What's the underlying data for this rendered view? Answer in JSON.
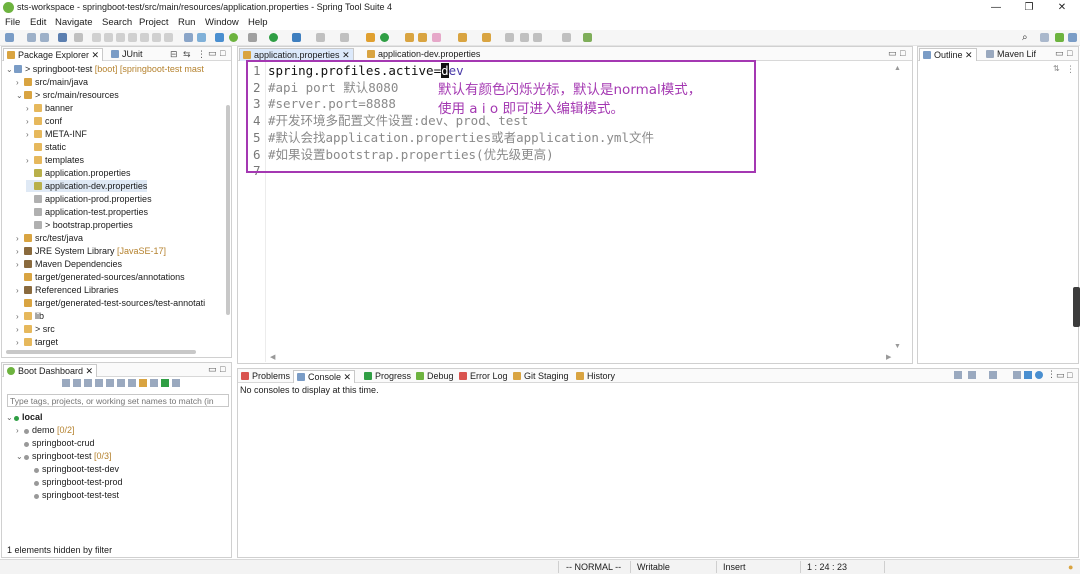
{
  "window": {
    "title": "sts-workspace - springboot-test/src/main/resources/application.properties - Spring Tool Suite 4",
    "min_glyph": "—",
    "max_glyph": "❐",
    "close_glyph": "✕"
  },
  "menu": [
    "File",
    "Edit",
    "Navigate",
    "Search",
    "Project",
    "Run",
    "Window",
    "Help"
  ],
  "package_explorer": {
    "tabs": [
      "Package Explorer",
      "JUnit"
    ],
    "items": [
      {
        "label": "> springboot-test",
        "extra": "[boot] [springboot-test mast",
        "depth": 0,
        "arrow": "v",
        "icon": "project"
      },
      {
        "label": "src/main/java",
        "depth": 1,
        "arrow": ">",
        "icon": "srcfolder"
      },
      {
        "label": "> src/main/resources",
        "depth": 1,
        "arrow": "v",
        "icon": "srcfolder"
      },
      {
        "label": "banner",
        "depth": 2,
        "arrow": ">",
        "icon": "folder"
      },
      {
        "label": "conf",
        "depth": 2,
        "arrow": ">",
        "icon": "folder"
      },
      {
        "label": "META-INF",
        "depth": 2,
        "arrow": ">",
        "icon": "folder"
      },
      {
        "label": "static",
        "depth": 2,
        "arrow": "",
        "icon": "folder"
      },
      {
        "label": "templates",
        "depth": 2,
        "arrow": ">",
        "icon": "folder"
      },
      {
        "label": "application.properties",
        "depth": 2,
        "arrow": "",
        "icon": "propfile"
      },
      {
        "label": "application-dev.properties",
        "depth": 2,
        "arrow": "",
        "icon": "propfile",
        "selected": true
      },
      {
        "label": "application-prod.properties",
        "depth": 2,
        "arrow": "",
        "icon": "file"
      },
      {
        "label": "application-test.properties",
        "depth": 2,
        "arrow": "",
        "icon": "file"
      },
      {
        "label": "> bootstrap.properties",
        "depth": 2,
        "arrow": "",
        "icon": "file"
      },
      {
        "label": "src/test/java",
        "depth": 1,
        "arrow": ">",
        "icon": "srcfolder"
      },
      {
        "label": "JRE System Library",
        "extra": "[JavaSE-17]",
        "depth": 1,
        "arrow": ">",
        "icon": "lib"
      },
      {
        "label": "Maven Dependencies",
        "depth": 1,
        "arrow": ">",
        "icon": "lib"
      },
      {
        "label": "target/generated-sources/annotations",
        "depth": 1,
        "arrow": "",
        "icon": "srcfolder"
      },
      {
        "label": "Referenced Libraries",
        "depth": 1,
        "arrow": ">",
        "icon": "lib"
      },
      {
        "label": "target/generated-test-sources/test-annotati",
        "depth": 1,
        "arrow": "",
        "icon": "srcfolder"
      },
      {
        "label": "lib",
        "depth": 1,
        "arrow": ">",
        "icon": "folder"
      },
      {
        "label": "> src",
        "depth": 1,
        "arrow": ">",
        "icon": "folder"
      },
      {
        "label": "target",
        "depth": 1,
        "arrow": ">",
        "icon": "folder"
      }
    ]
  },
  "boot_dashboard": {
    "tab": "Boot Dashboard",
    "filter_placeholder": "Type tags, projects, or working set names to match (in",
    "items": [
      {
        "label": "local",
        "depth": 0,
        "arrow": "v",
        "bold": true
      },
      {
        "label": "demo",
        "extra": "[0/2]",
        "depth": 1,
        "arrow": ">"
      },
      {
        "label": "springboot-crud",
        "depth": 1,
        "arrow": ""
      },
      {
        "label": "springboot-test",
        "extra": "[0/3]",
        "depth": 1,
        "arrow": "v"
      },
      {
        "label": "springboot-test-dev",
        "depth": 2,
        "arrow": ""
      },
      {
        "label": "springboot-test-prod",
        "depth": 2,
        "arrow": ""
      },
      {
        "label": "springboot-test-test",
        "depth": 2,
        "arrow": ""
      }
    ],
    "footer": "1 elements hidden by filter"
  },
  "editor": {
    "tabs": [
      "application.properties",
      "application-dev.properties"
    ],
    "lines": [
      {
        "num": "1",
        "text": "spring.profiles.active=",
        "cursor": "d",
        "rest": "ev",
        "comment": false
      },
      {
        "num": "2",
        "text": "#api port 默认8080",
        "comment": true
      },
      {
        "num": "3",
        "text": "#server.port=8888",
        "comment": true
      },
      {
        "num": "4",
        "text": "#开发环境多配置文件设置:dev、prod、test",
        "comment": true
      },
      {
        "num": "5",
        "text": "#默认会找application.properties或者application.yml文件",
        "comment": true
      },
      {
        "num": "6",
        "text": "#如果设置bootstrap.properties(优先级更高)",
        "comment": true
      },
      {
        "num": "7",
        "text": "",
        "comment": false
      }
    ],
    "annotation_line1": "默认有颜色闪烁光标，默认是normal模式，",
    "annotation_line2": "使用 a i o 即可进入编辑模式。"
  },
  "outline": {
    "tabs": [
      "Outline",
      "Maven Lif"
    ]
  },
  "console": {
    "tabs": [
      "Problems",
      "Console",
      "Progress",
      "Debug",
      "Error Log",
      "Git Staging",
      "History"
    ],
    "message": "No consoles to display at this time."
  },
  "status": {
    "mode": "-- NORMAL --",
    "writable": "Writable",
    "insert": "Insert",
    "position": "1 : 24 : 23"
  },
  "colors": {
    "annotation": "#a438b2",
    "spring_green": "#6db33f",
    "selection": "#dfe9f5"
  }
}
